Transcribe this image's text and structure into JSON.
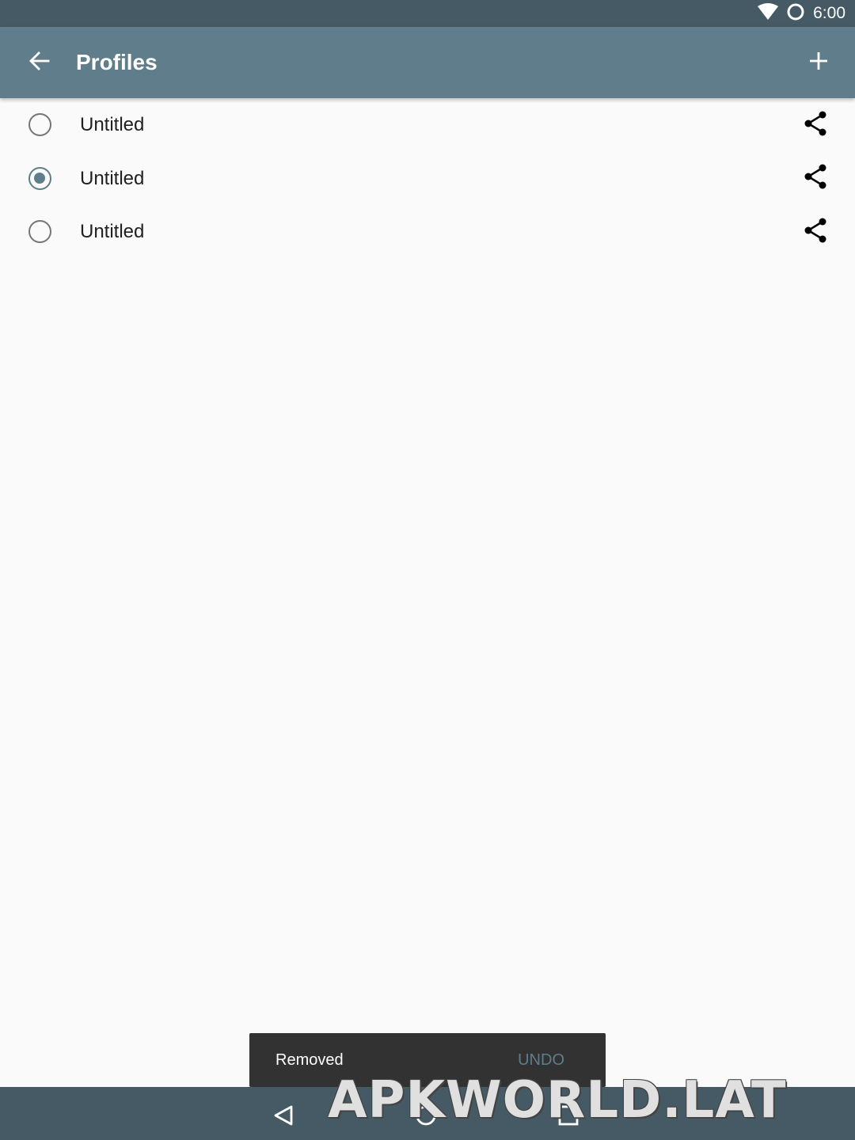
{
  "status_bar": {
    "time": "6:00",
    "icons": [
      "wifi-icon",
      "sync-circle-icon"
    ]
  },
  "app_bar": {
    "title": "Profiles",
    "back_icon": "arrow-back-icon",
    "add_icon": "plus-icon"
  },
  "profiles": [
    {
      "name": "Untitled",
      "selected": false
    },
    {
      "name": "Untitled",
      "selected": true
    },
    {
      "name": "Untitled",
      "selected": false
    }
  ],
  "snackbar": {
    "message": "Removed",
    "action": "UNDO"
  },
  "nav_bar": {
    "icons": [
      "nav-back-icon",
      "nav-home-icon",
      "nav-recents-icon"
    ]
  },
  "watermark": "APKWORLD.LAT",
  "colors": {
    "primary": "#607d8b",
    "primary_dark": "#455a64",
    "background": "#fafafa",
    "snackbar": "#323232"
  }
}
